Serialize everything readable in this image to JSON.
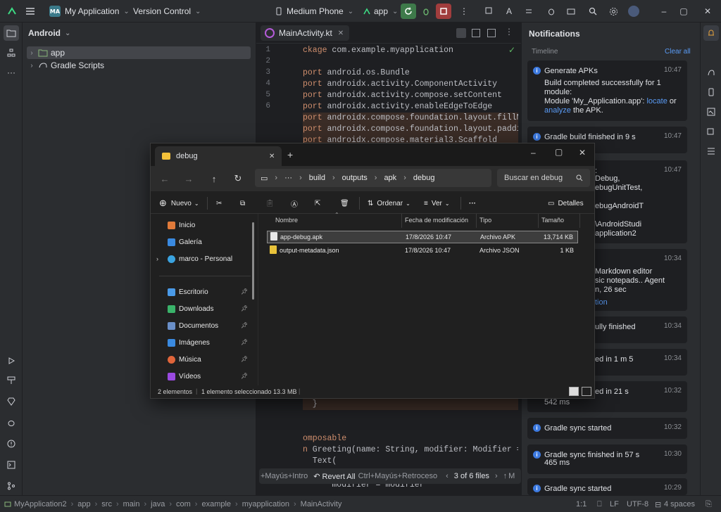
{
  "ide": {
    "project_badge": "MA",
    "project_name": "My Application",
    "vcs": "Version Control",
    "device": "Medium Phone",
    "run_config": "app",
    "colors": {
      "accent": "#3574f0",
      "run": "#3e7a4a",
      "stop": "#a13d3d"
    }
  },
  "project_panel": {
    "title": "Android",
    "items": [
      {
        "label": "app"
      },
      {
        "label": "Gradle Scripts"
      }
    ]
  },
  "editor": {
    "tab": "MainActivity.kt",
    "line_numbers": [
      "1",
      "2",
      "3",
      "4",
      "5",
      "6"
    ],
    "lines": [
      {
        "kw": "ckage",
        "rest": " com.example.myapplication"
      },
      {
        "kw": "",
        "rest": ""
      },
      {
        "kw": "port",
        "rest": " android.os.Bundle"
      },
      {
        "kw": "port",
        "rest": " androidx.activity.ComponentActivity"
      },
      {
        "kw": "port",
        "rest": " androidx.activity.compose.setContent"
      },
      {
        "kw": "port",
        "rest": " androidx.activity.enableEdgeToEdge"
      },
      {
        "kw": "port",
        "rest": " androidx.compose.foundation.layout.fillMaxSize"
      },
      {
        "kw": "port",
        "rest": " androidx.compose.foundation.layout.padding"
      },
      {
        "kw": "port",
        "rest": " androidx.compose.material3.Scaffold"
      }
    ],
    "lower_lines": [
      {
        "kw": "",
        "rest": "  }"
      },
      {
        "kw": "",
        "rest": ""
      },
      {
        "kw": "",
        "rest": ""
      },
      {
        "kw": "omposable",
        "rest": ""
      },
      {
        "kw": "n",
        "rest": " Greeting(name: String, modifier: Modifier = Modifi"
      },
      {
        "kw": "",
        "rest": "  Text("
      },
      {
        "kw": "",
        "rest": "      modifier = modifier"
      }
    ],
    "bottom_bar": {
      "hint": "+Mayús+Intro",
      "revert": "Revert All",
      "revert_shortcut": "Ctrl+Mayús+Retroceso",
      "files_count": "3 of 6 files",
      "more": "M"
    }
  },
  "notifications": {
    "title": "Notifications",
    "timeline": "Timeline",
    "clear_all": "Clear all",
    "items": [
      {
        "title": "Generate APKs",
        "time": "10:47",
        "body1": "Build completed successfully for 1 module:",
        "body2": "Module 'My_Application.app': ",
        "link1": "locate",
        "body3": " or ",
        "link2": "analyze",
        "body4": " the APK."
      },
      {
        "title": "Gradle build finished in 9 s",
        "time": "10:47"
      },
      {
        "title": ":",
        "time": "10:47",
        "body": "Debug,\nebugUnitTest,\n\nebugAndroidT\n\n\\AndroidStudi\napplication2"
      },
      {
        "title": "",
        "time": "10:34",
        "body": "Markdown editor\nsic notepads.. Agent\nn, 26 sec",
        "link": "tion"
      },
      {
        "title": "ully finished",
        "time": "10:34"
      },
      {
        "title": "ed in 1 m 5",
        "time": "10:34"
      },
      {
        "title": "ed in 21 s",
        "time": "10:32",
        "sub": "542 ms"
      },
      {
        "title": "Gradle sync started",
        "time": "10:32"
      },
      {
        "title": "Gradle sync finished in 57 s",
        "time": "10:30",
        "sub": "465 ms"
      },
      {
        "title": "Gradle sync started",
        "time": "10:29"
      }
    ]
  },
  "statusbar": {
    "crumbs": [
      "MyApplication2",
      "app",
      "src",
      "main",
      "java",
      "com",
      "example",
      "myapplication",
      "MainActivity"
    ],
    "position": "1:1",
    "line_sep": "LF",
    "encoding": "UTF-8",
    "indent": "4 spaces"
  },
  "explorer": {
    "tab_title": "debug",
    "address": [
      "build",
      "outputs",
      "apk",
      "debug"
    ],
    "search_placeholder": "Buscar en debug",
    "commands": {
      "new": "Nuevo",
      "sort": "Ordenar",
      "view": "Ver",
      "more": "···",
      "details": "Detalles"
    },
    "nav_items": [
      {
        "label": "Inicio",
        "color": "#e07a3a"
      },
      {
        "label": "Galería",
        "color": "#3a8ae0"
      },
      {
        "label": "marco - Personal",
        "color": "#3aa3e0"
      },
      {
        "label": "Escritorio",
        "color": "#4a9ae8"
      },
      {
        "label": "Downloads",
        "color": "#3ab36a"
      },
      {
        "label": "Documentos",
        "color": "#6a8fc8"
      },
      {
        "label": "Imágenes",
        "color": "#3a8ae0"
      },
      {
        "label": "Música",
        "color": "#e0653a"
      },
      {
        "label": "Vídeos",
        "color": "#9a4ae0"
      }
    ],
    "columns": [
      "Nombre",
      "Fecha de modificación",
      "Tipo",
      "Tamaño"
    ],
    "files": [
      {
        "name": "app-debug.apk",
        "date": "17/8/2026 10:47",
        "type": "Archivo APK",
        "size": "13,714 KB"
      },
      {
        "name": "output-metadata.json",
        "date": "17/8/2026 10:47",
        "type": "Archivo JSON",
        "size": "1 KB"
      }
    ],
    "status": {
      "count": "2 elementos",
      "selected": "1 elemento seleccionado",
      "size": "13.3 MB"
    }
  }
}
